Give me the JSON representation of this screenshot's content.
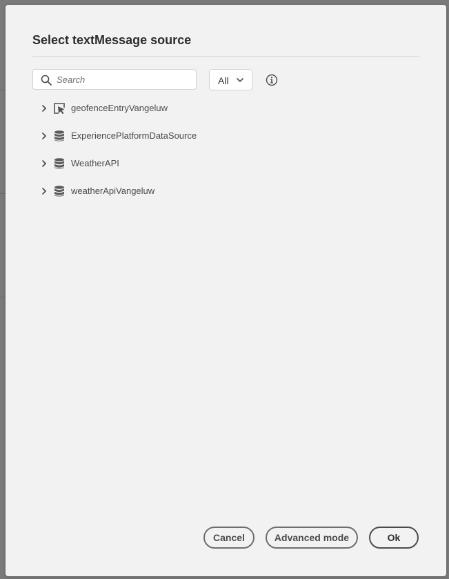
{
  "dialog": {
    "title": "Select textMessage source",
    "search": {
      "placeholder": "Search",
      "value": ""
    },
    "filter": {
      "selected": "All"
    },
    "tree": {
      "items": [
        {
          "name": "geofenceEntryVangeluw",
          "icon": "event-pointer-icon"
        },
        {
          "name": "ExperiencePlatformDataSource",
          "icon": "database-icon"
        },
        {
          "name": "WeatherAPI",
          "icon": "database-icon"
        },
        {
          "name": "weatherApiVangeluw",
          "icon": "database-icon"
        }
      ]
    },
    "footer": {
      "cancel_label": "Cancel",
      "advanced_label": "Advanced mode",
      "ok_label": "Ok"
    }
  }
}
